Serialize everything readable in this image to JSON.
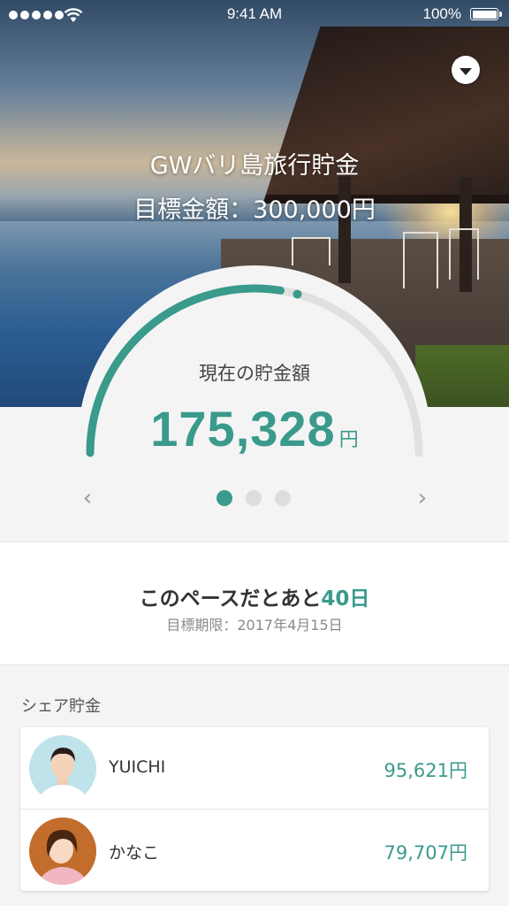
{
  "status_bar": {
    "time": "9:41 AM",
    "battery": "100%"
  },
  "goal": {
    "title": "GWバリ島旅行貯金",
    "target": "目標金額：300,000円"
  },
  "savings": {
    "label": "現在の貯金額",
    "amount": "175,328",
    "unit": "円",
    "progress": 0.584
  },
  "pager": {
    "count": 3,
    "active": 0
  },
  "pace": {
    "prefix": "このペースだとあと",
    "days": "40日",
    "deadline": "目標期限：2017年4月15日"
  },
  "share": {
    "title": "シェア貯金",
    "members": [
      {
        "name": "YUICHI",
        "amount": "95,621円"
      },
      {
        "name": "かなこ",
        "amount": "79,707円"
      }
    ]
  },
  "colors": {
    "accent": "#3a9a8c",
    "track": "#e0e0e0"
  },
  "icons": {
    "menu": "dropdown-triangle-icon",
    "prev": "chevron-left-icon",
    "next": "chevron-right-icon"
  }
}
